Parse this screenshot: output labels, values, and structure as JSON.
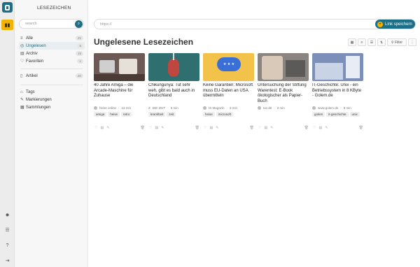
{
  "rail": {
    "logo_icon": "app-logo",
    "active_icon": "bookmarks-icon",
    "bottom_icons": [
      "theme-icon",
      "settings-icon",
      "help-icon",
      "logout-icon"
    ]
  },
  "sidebar": {
    "title": "LESEZEICHEN",
    "search_placeholder": "search",
    "main_items": [
      {
        "label": "Alle",
        "icon": "list-icon",
        "count": "21"
      },
      {
        "label": "Ungelesen",
        "icon": "check-circle-icon",
        "count": "6"
      },
      {
        "label": "Archiv",
        "icon": "archive-icon",
        "count": "15"
      },
      {
        "label": "Favoriten",
        "icon": "heart-icon",
        "count": "1"
      }
    ],
    "article_item": {
      "label": "Artikel",
      "icon": "document-icon",
      "count": "20"
    },
    "extra_items": [
      {
        "label": "Tags",
        "icon": "tag-icon"
      },
      {
        "label": "Markierungen",
        "icon": "pen-icon"
      },
      {
        "label": "Sammlungen",
        "icon": "collection-icon"
      }
    ]
  },
  "main": {
    "url_placeholder": "https://",
    "save_label": "Link speichern",
    "page_title": "Ungelesene Lesezeichen",
    "filter_label": "Filter",
    "cards": [
      {
        "title": "40 Jahre Amiga – die Arcade-Maschine für Zuhause",
        "source": "heise online",
        "time": "13 min",
        "tags": [
          "amiga",
          "heise",
          "retro"
        ],
        "image_color": "#6b5a55"
      },
      {
        "title": "Chikungunya: Tut sehr weh, gibt es bald auch in Deutschland",
        "source": "DIE ZEIT",
        "time": "6 min",
        "tags": [
          "krankheit",
          "zeit"
        ],
        "image_color": "#2f6f70"
      },
      {
        "title": "Keine Garantien: Microsoft muss EU-Daten an USA übermitteln",
        "source": "IX Magazin",
        "time": "3 min",
        "tags": [
          "heise",
          "microsoft"
        ],
        "image_color": "#f2c24a"
      },
      {
        "title": "Untersuchung der Stiftung Warentest: E-Book ökologischer als Papier-Buch",
        "source": "taz.de",
        "time": "2 min",
        "tags": [],
        "image_color": "#8a8580"
      },
      {
        "title": "IT-Geschichte: Unix - ein Betriebssystem in 8 KByte - Golem.de",
        "source": "www.golem.de",
        "time": "8 min",
        "tags": [
          "golem",
          "it-geschichte",
          "unix"
        ],
        "image_color": "#7b8fb8"
      }
    ]
  }
}
